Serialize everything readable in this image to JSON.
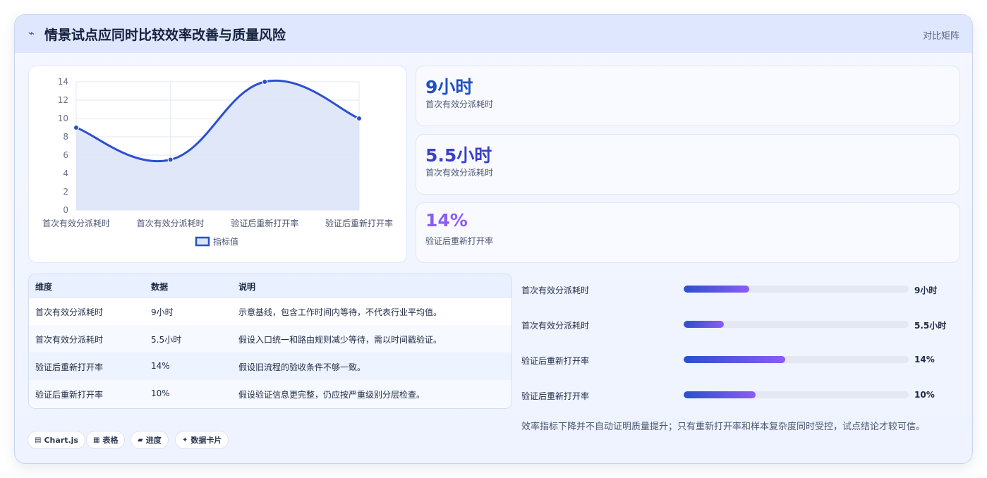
{
  "header": {
    "icon": "trend-icon",
    "title": "情景试点应同时比较效率改善与质量风险",
    "mode_label": "对比矩阵"
  },
  "chart_data": {
    "type": "line",
    "categories": [
      "首次有效分派耗时",
      "首次有效分派耗时",
      "验证后重新打开率",
      "验证后重新打开率"
    ],
    "series": [
      {
        "name": "指标值",
        "values": [
          9,
          5.5,
          14,
          10
        ]
      }
    ],
    "ylim": [
      0,
      14
    ],
    "yticks": [
      0,
      2,
      4,
      6,
      8,
      10,
      12,
      14
    ],
    "grid": true,
    "legend": "bottom",
    "line_color": "#2a4fcf",
    "fill_color": "#dde4f7"
  },
  "stats": [
    {
      "value": "9小时",
      "label": "首次有效分派耗时",
      "color": "#1f4fc4"
    },
    {
      "value": "5.5小时",
      "label": "首次有效分派耗时",
      "color": "#3b40c8"
    },
    {
      "value": "14%",
      "label": "验证后重新打开率",
      "color": "#8b5cf6"
    }
  ],
  "table": {
    "headers": [
      "维度",
      "数据",
      "说明"
    ],
    "rows": [
      [
        "首次有效分派耗时",
        "9小时",
        "示意基线，包含工作时间内等待，不代表行业平均值。"
      ],
      [
        "首次有效分派耗时",
        "5.5小时",
        "假设入口统一和路由规则减少等待，需以时间戳验证。"
      ],
      [
        "验证后重新打开率",
        "14%",
        "假设旧流程的验收条件不够一致。"
      ],
      [
        "验证后重新打开率",
        "10%",
        "假设验证信息更完整，仍应按严重级别分层检查。"
      ]
    ]
  },
  "progress": [
    {
      "label": "首次有效分派耗时",
      "value": "9小时",
      "fraction": 0.29
    },
    {
      "label": "首次有效分派耗时",
      "value": "5.5小时",
      "fraction": 0.18
    },
    {
      "label": "验证后重新打开率",
      "value": "14%",
      "fraction": 0.45
    },
    {
      "label": "验证后重新打开率",
      "value": "10%",
      "fraction": 0.32
    }
  ],
  "note": "效率指标下降并不自动证明质量提升；只有重新打开率和样本复杂度同时受控，试点结论才较可信。",
  "chips": [
    {
      "icon": "chart-icon",
      "glyph": "▤",
      "label": "Chart.js"
    },
    {
      "icon": "table-icon",
      "glyph": "▦",
      "label": "表格"
    },
    {
      "icon": "progress-icon",
      "glyph": "▰",
      "label": "进度"
    },
    {
      "icon": "sparkle-icon",
      "glyph": "✦",
      "label": "数据卡片"
    }
  ]
}
